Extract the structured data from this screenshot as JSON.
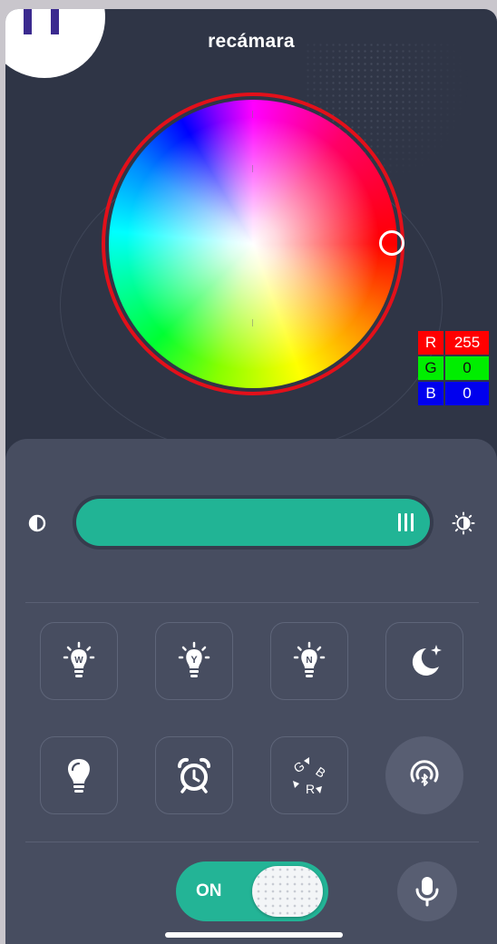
{
  "header": {
    "title": "recámara"
  },
  "color": {
    "selected_hex": "#ff0000",
    "rgb": [
      {
        "key": "R",
        "value": "255"
      },
      {
        "key": "G",
        "value": "0"
      },
      {
        "key": "B",
        "value": "0"
      }
    ]
  },
  "brightness": {
    "level_percent": 100
  },
  "modes": [
    {
      "name": "warm-white",
      "letter": "W"
    },
    {
      "name": "yellow",
      "letter": "Y"
    },
    {
      "name": "natural",
      "letter": "N"
    },
    {
      "name": "night",
      "icon": "moon-icon"
    },
    {
      "name": "bulb",
      "icon": "bulb-icon"
    },
    {
      "name": "alarm",
      "icon": "alarm-clock-icon"
    },
    {
      "name": "rgb-cycle",
      "letters": [
        "G",
        "B",
        "R"
      ]
    },
    {
      "name": "bluetooth-speaker",
      "icon": "bluetooth-sound-icon"
    }
  ],
  "power": {
    "label": "ON",
    "state": true
  },
  "colors": {
    "accent": "#21b495",
    "panel": "#474d60",
    "background": "#2f3546",
    "ring": "#e3101a"
  }
}
